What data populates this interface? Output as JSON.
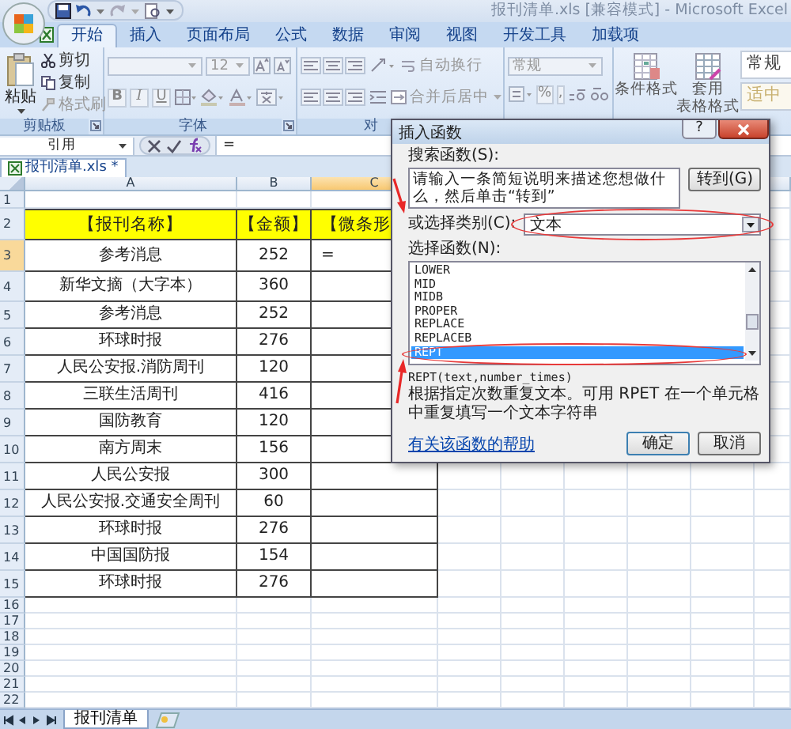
{
  "window": {
    "title": "报刊清单.xls [兼容模式] - Microsoft Excel"
  },
  "ribbon_tabs": [
    {
      "label": "开始",
      "selected": true
    },
    {
      "label": "插入",
      "selected": false
    },
    {
      "label": "页面布局",
      "selected": false
    },
    {
      "label": "公式",
      "selected": false
    },
    {
      "label": "数据",
      "selected": false
    },
    {
      "label": "审阅",
      "selected": false
    },
    {
      "label": "视图",
      "selected": false
    },
    {
      "label": "开发工具",
      "selected": false
    },
    {
      "label": "加载项",
      "selected": false
    }
  ],
  "ribbon": {
    "clipboard": {
      "paste": "粘贴",
      "cut": "剪切",
      "copy": "复制",
      "format_painter": "格式刷",
      "label": "剪贴板"
    },
    "font": {
      "size": "12",
      "bold": "B",
      "italic": "I",
      "underline": "U",
      "label": "字体"
    },
    "alignment": {
      "wrap_text": "自动换行",
      "merge_center": "合并后居中",
      "label": "对"
    },
    "number": {
      "format": "常规",
      "percent": "%",
      "comma": ","
    },
    "styles": {
      "conditional_formatting": "条件格式",
      "format_as_table": [
        "套用",
        "表格格式"
      ],
      "cell_styles": [
        "常规",
        "适中"
      ]
    }
  },
  "formula_bar": {
    "name_box": "引用",
    "formula": "="
  },
  "workbook_tab": {
    "label": "报刊清单.xls *"
  },
  "sheet": {
    "columns": [
      {
        "label": "A",
        "selected": false
      },
      {
        "label": "B",
        "selected": false
      },
      {
        "label": "C",
        "selected": true
      }
    ],
    "rows": [
      {
        "number": "1",
        "kind": "blank",
        "selected": false,
        "cells": []
      },
      {
        "number": "2",
        "kind": "header",
        "selected": false,
        "cells": [
          "【报刊名称】",
          "【金额】",
          "【微条形"
        ]
      },
      {
        "number": "3",
        "kind": "data",
        "selected": true,
        "cells": [
          "参考消息",
          "252",
          "="
        ]
      },
      {
        "number": "4",
        "kind": "data",
        "selected": false,
        "cells": [
          "新华文摘（大字本）",
          "360"
        ]
      },
      {
        "number": "5",
        "kind": "data",
        "selected": false,
        "cells": [
          "参考消息",
          "252"
        ]
      },
      {
        "number": "6",
        "kind": "data",
        "selected": false,
        "cells": [
          "环球时报",
          "276"
        ]
      },
      {
        "number": "7",
        "kind": "data",
        "selected": false,
        "cells": [
          "人民公安报.消防周刊",
          "120"
        ]
      },
      {
        "number": "8",
        "kind": "data",
        "selected": false,
        "cells": [
          "三联生活周刊",
          "416"
        ]
      },
      {
        "number": "9",
        "kind": "data",
        "selected": false,
        "cells": [
          "国防教育",
          "120"
        ]
      },
      {
        "number": "10",
        "kind": "data",
        "selected": false,
        "cells": [
          "南方周末",
          "156"
        ]
      },
      {
        "number": "11",
        "kind": "data",
        "selected": false,
        "cells": [
          "人民公安报",
          "300"
        ]
      },
      {
        "number": "12",
        "kind": "data",
        "selected": false,
        "cells": [
          "人民公安报.交通安全周刊",
          "60"
        ]
      },
      {
        "number": "13",
        "kind": "data",
        "selected": false,
        "cells": [
          "环球时报",
          "276"
        ]
      },
      {
        "number": "14",
        "kind": "data",
        "selected": false,
        "cells": [
          "中国国防报",
          "154"
        ]
      },
      {
        "number": "15",
        "kind": "data",
        "selected": false,
        "cells": [
          "环球时报",
          "276"
        ]
      },
      {
        "number": "16",
        "kind": "blank",
        "selected": false,
        "cells": []
      },
      {
        "number": "17",
        "kind": "blank",
        "selected": false,
        "cells": []
      },
      {
        "number": "18",
        "kind": "blank",
        "selected": false,
        "cells": []
      },
      {
        "number": "19",
        "kind": "blank",
        "selected": false,
        "cells": []
      },
      {
        "number": "20",
        "kind": "blank",
        "selected": false,
        "cells": []
      },
      {
        "number": "21",
        "kind": "blank",
        "selected": false,
        "cells": []
      },
      {
        "number": "22",
        "kind": "blank",
        "selected": false,
        "cells": []
      }
    ]
  },
  "sheet_tabs": [
    {
      "label": "报刊清单",
      "selected": true
    }
  ],
  "dialog": {
    "title": "插入函数",
    "help_button": "?",
    "search_label": "搜索函数(S):",
    "search_value": "请输入一条简短说明来描述您想做什么，然后单击“转到”",
    "go_button": "转到(G)",
    "category_label": "或选择类别(C):",
    "category": "文本",
    "function_label": "选择函数(N):",
    "functions": [
      {
        "name": "LOWER",
        "selected": false
      },
      {
        "name": "MID",
        "selected": false
      },
      {
        "name": "MIDB",
        "selected": false
      },
      {
        "name": "PROPER",
        "selected": false
      },
      {
        "name": "REPLACE",
        "selected": false
      },
      {
        "name": "REPLACEB",
        "selected": false
      },
      {
        "name": "REPT",
        "selected": true
      }
    ],
    "signature": "REPT(text,number_times)",
    "description": "根据指定次数重复文本。可用 RPET 在一个单元格中重复填写一个文本字符串",
    "help_link": "有关该函数的帮助",
    "ok_button": "确定",
    "cancel_button": "取消"
  }
}
